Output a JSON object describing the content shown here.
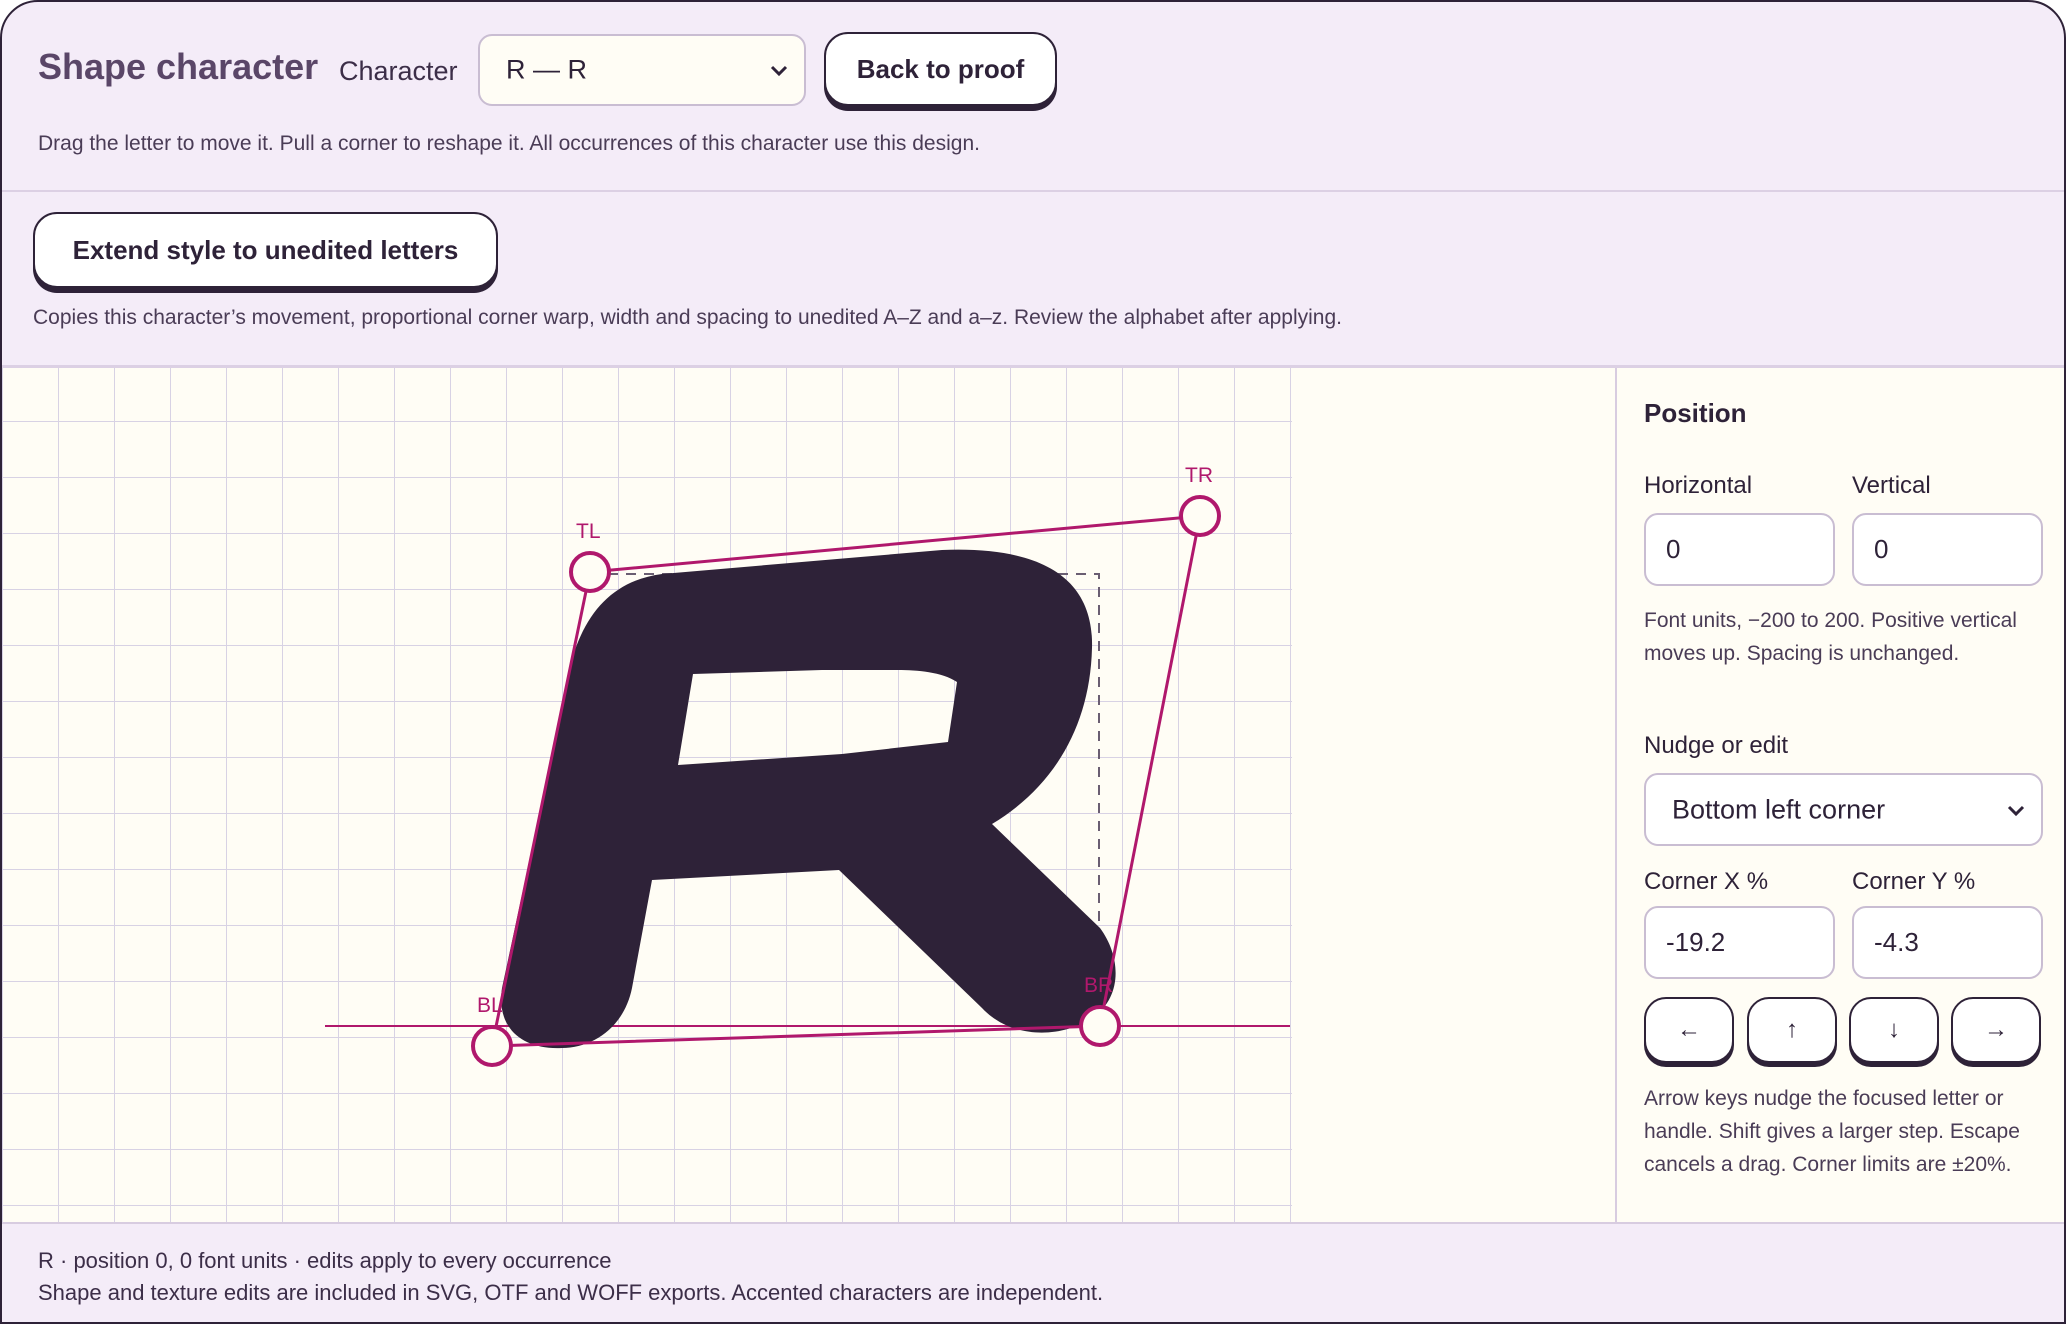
{
  "header": {
    "title": "Shape character",
    "character_label": "Character",
    "character_value": "R — R",
    "back_button": "Back to proof",
    "help": "Drag the letter to move it. Pull a corner to reshape it. All occurrences of this character use this design."
  },
  "extend": {
    "button": "Extend style to unedited letters",
    "help": "Copies this character’s movement, proportional corner warp, width and spacing to unedited A–Z and a–z. Review the alphabet after applying."
  },
  "canvas": {
    "glyph": "R",
    "handles": {
      "tl": "TL",
      "tr": "TR",
      "bl": "BL",
      "br": "BR"
    },
    "colors": {
      "accent": "#b0186c",
      "ink": "#2e2238",
      "grid": "#d8d2e4",
      "paper": "#fffdf5"
    }
  },
  "panel": {
    "heading": "Position",
    "horizontal_label": "Horizontal",
    "horizontal_value": "0",
    "vertical_label": "Vertical",
    "vertical_value": "0",
    "position_note": "Font units, −200 to 200. Positive vertical moves up. Spacing is unchanged.",
    "nudge_label": "Nudge or edit",
    "nudge_value": "Bottom left corner",
    "corner_x_label": "Corner X %",
    "corner_x_value": "-19.2",
    "corner_y_label": "Corner Y %",
    "corner_y_value": "-4.3",
    "arrows": {
      "left": "←",
      "up": "↑",
      "down": "↓",
      "right": "→"
    },
    "keys_note": "Arrow keys nudge the focused letter or handle. Shift gives a larger step. Escape cancels a drag. Corner limits are ±20%."
  },
  "footer": {
    "status": "R · position 0, 0 font units · edits apply to every occurrence",
    "exports": "Shape and texture edits are included in SVG, OTF and WOFF exports. Accented characters are independent."
  }
}
